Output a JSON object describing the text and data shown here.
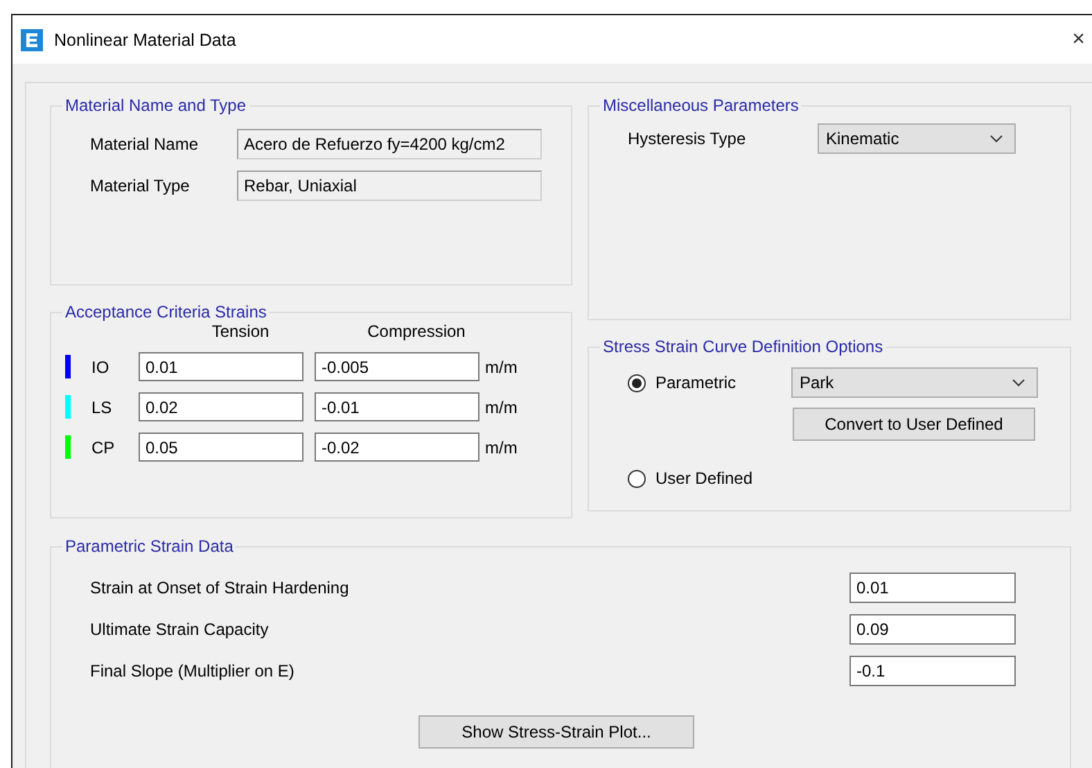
{
  "window": {
    "title": "Nonlinear Material Data",
    "close": "×"
  },
  "material": {
    "title": "Material Name and Type",
    "fields": [
      {
        "label": "Material Name",
        "value": "Acero de Refuerzo fy=4200 kg/cm2"
      },
      {
        "label": "Material Type",
        "value": "Rebar, Uniaxial"
      }
    ]
  },
  "acceptance": {
    "title": "Acceptance Criteria Strains",
    "columns": [
      "Tension",
      "Compression"
    ],
    "rows": [
      {
        "label": "IO",
        "color": "#0000ff",
        "tension": "0.01",
        "compression": "-0.005",
        "unit": "m/m"
      },
      {
        "label": "LS",
        "color": "#00ffff",
        "tension": "0.02",
        "compression": "-0.01",
        "unit": "m/m"
      },
      {
        "label": "CP",
        "color": "#00ff00",
        "tension": "0.05",
        "compression": "-0.02",
        "unit": "m/m"
      }
    ]
  },
  "misc": {
    "title": "Miscellaneous Parameters",
    "hysteresis": {
      "label": "Hysteresis Type",
      "value": "Kinematic"
    }
  },
  "curve": {
    "title": "Stress Strain Curve Definition Options",
    "options": [
      {
        "label": "Parametric",
        "selected": true
      },
      {
        "label": "User Defined",
        "selected": false
      }
    ],
    "model": "Park",
    "convert_button": "Convert to User Defined"
  },
  "parametric": {
    "title": "Parametric Strain Data",
    "fields": [
      {
        "label": "Strain at Onset of Strain Hardening",
        "value": "0.01"
      },
      {
        "label": "Ultimate Strain Capacity",
        "value": "0.09"
      },
      {
        "label": "Final Slope (Multiplier on E)",
        "value": "-0.1"
      }
    ],
    "plot_button": "Show Stress-Strain Plot..."
  }
}
